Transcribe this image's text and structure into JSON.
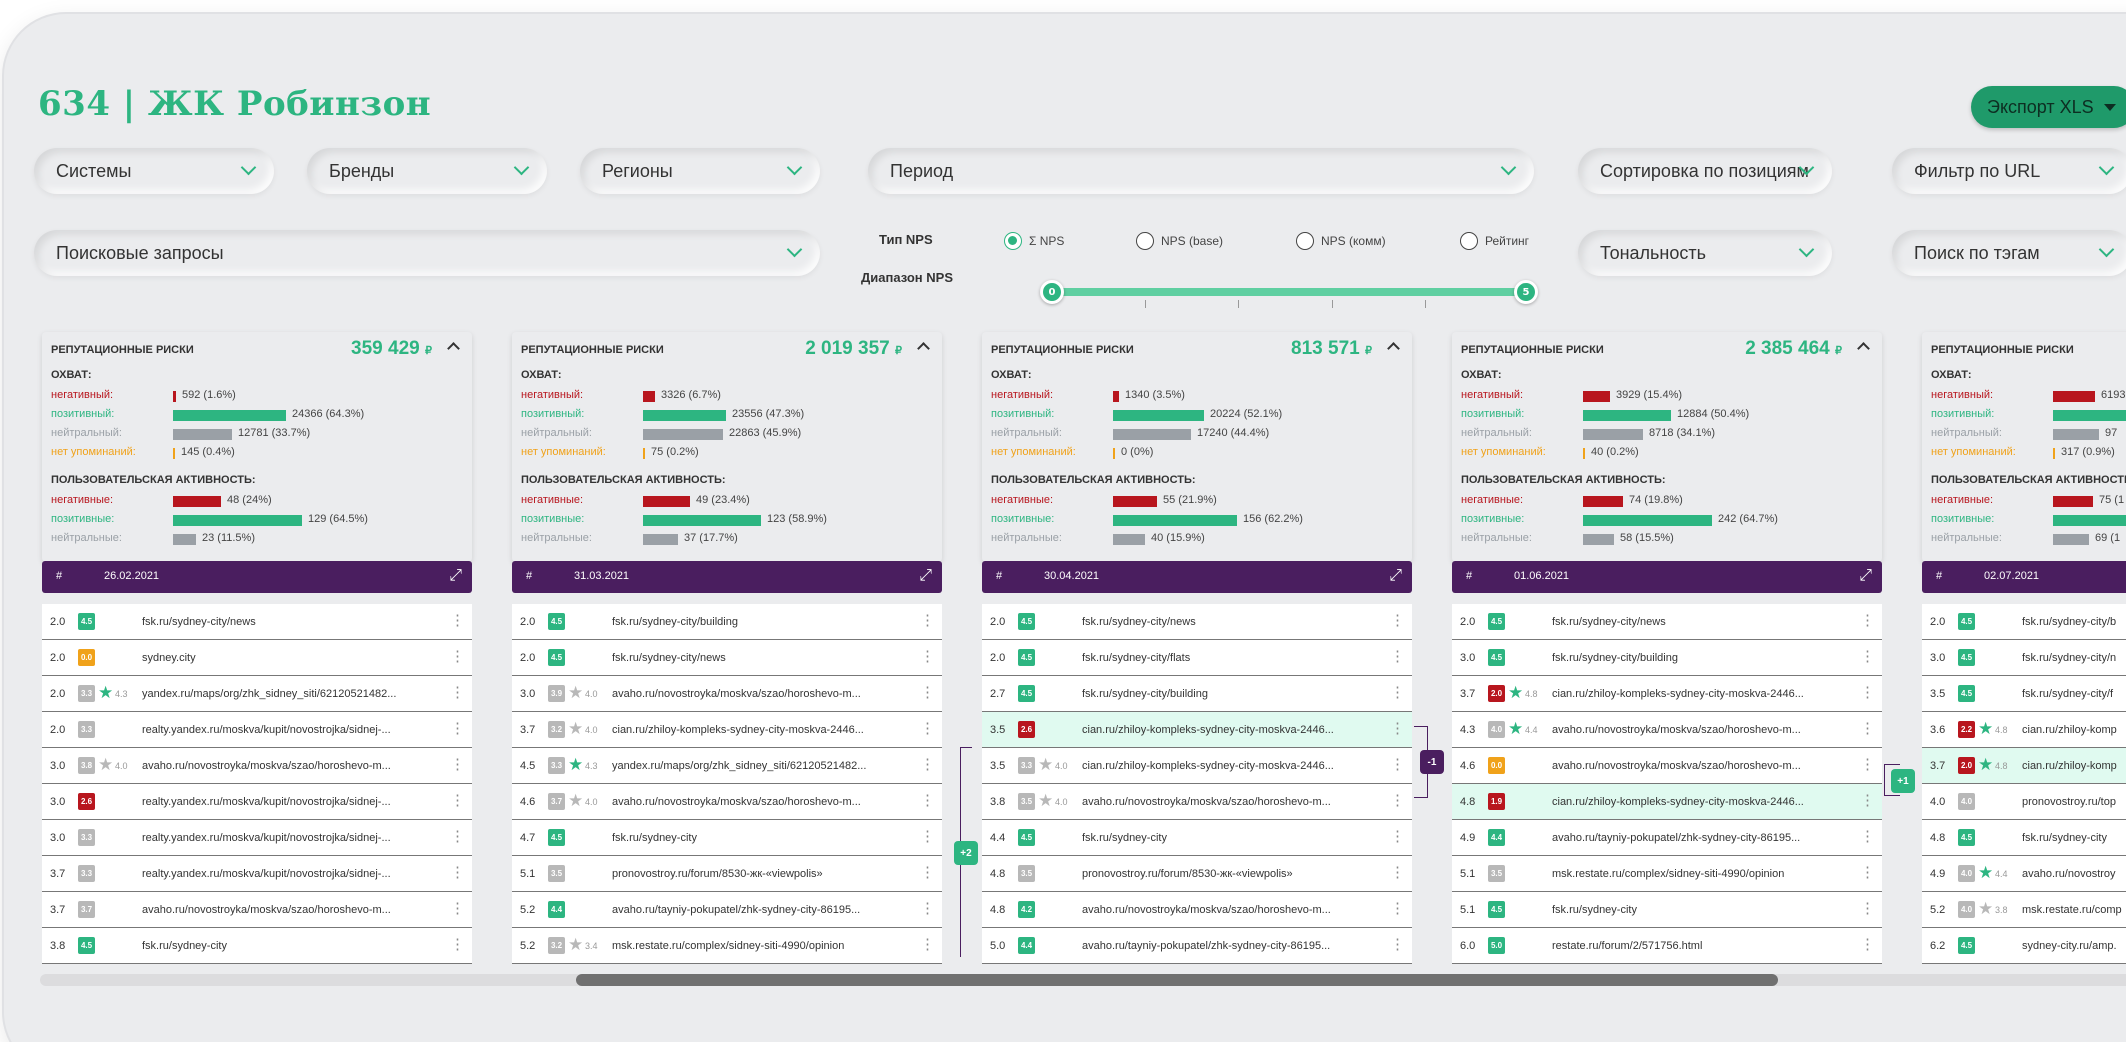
{
  "title": "634 | ЖК Робинзон",
  "export_button": "Экспорт XLS",
  "filters": {
    "systems": "Системы",
    "brands": "Бренды",
    "regions": "Регионы",
    "period": "Период",
    "sort": "Сортировка по позициям",
    "url_filter": "Фильтр по URL",
    "queries": "Поисковые запросы",
    "tonality": "Тональность",
    "tag_search": "Поиск по тэгам"
  },
  "nps": {
    "type_label": "Тип NPS",
    "range_label": "Диапазон NPS",
    "options": [
      {
        "label": "Σ NPS",
        "selected": true
      },
      {
        "label": "NPS (base)",
        "selected": false
      },
      {
        "label": "NPS (комм)",
        "selected": false
      },
      {
        "label": "Рейтинг",
        "selected": false
      }
    ],
    "range_min": "0",
    "range_max": "5"
  },
  "labels": {
    "risks": "РЕПУТАЦИОННЫЕ РИСКИ",
    "reach": "ОХВАТ:",
    "activity": "ПОЛЬЗОВАТЕЛЬСКАЯ АКТИВНОСТЬ:",
    "neg": "негативный:",
    "pos": "позитивный:",
    "neu": "нейтральный:",
    "none": "нет упоминаний:",
    "neg_pl": "негативные:",
    "pos_pl": "позитивные:",
    "neu_pl": "нейтральные:",
    "hash": "#",
    "currency": "₽"
  },
  "colors": {
    "accent": "#2db581",
    "purple": "#4a1e5f",
    "negative": "#b8161e",
    "neutral": "#9aa0a6",
    "none": "#f0a21a",
    "score_green": "#2db581",
    "score_gray": "#b8b8b8",
    "score_orange": "#f0a21a",
    "score_red": "#b8161e"
  },
  "columns": [
    {
      "risk_total": "359 429",
      "date": "26.02.2021",
      "reach": [
        {
          "kind": "neg",
          "text": "592 (1.6%)",
          "frac": 0.016
        },
        {
          "kind": "pos",
          "text": "24366 (64.3%)",
          "frac": 0.643
        },
        {
          "kind": "neu",
          "text": "12781 (33.7%)",
          "frac": 0.337
        },
        {
          "kind": "none",
          "text": "145 (0.4%)",
          "frac": 0.004
        }
      ],
      "activity": [
        {
          "kind": "neg",
          "text": "48 (24%)",
          "frac": 0.24
        },
        {
          "kind": "pos",
          "text": "129 (64.5%)",
          "frac": 0.645
        },
        {
          "kind": "neu",
          "text": "23 (11.5%)",
          "frac": 0.115
        }
      ],
      "rows": [
        {
          "pos": "2.0",
          "score": "4.5",
          "color": "green",
          "star": "",
          "rating": "",
          "url": "fsk.ru/sydney-city/news"
        },
        {
          "pos": "2.0",
          "score": "0.0",
          "color": "orange",
          "star": "",
          "rating": "",
          "url": "sydney.city"
        },
        {
          "pos": "2.0",
          "score": "3.3",
          "color": "gray",
          "star": "green",
          "rating": "4.3",
          "url": "yandex.ru/maps/org/zhk_sidney_siti/62120521482..."
        },
        {
          "pos": "2.0",
          "score": "3.3",
          "color": "gray",
          "star": "",
          "rating": "",
          "url": "realty.yandex.ru/moskva/kupit/novostrojka/sidnej-..."
        },
        {
          "pos": "3.0",
          "score": "3.8",
          "color": "gray",
          "star": "gray",
          "rating": "4.0",
          "url": "avaho.ru/novostroyka/moskva/szao/horoshevo-m..."
        },
        {
          "pos": "3.0",
          "score": "2.6",
          "color": "red",
          "star": "",
          "rating": "",
          "url": "realty.yandex.ru/moskva/kupit/novostrojka/sidnej-..."
        },
        {
          "pos": "3.0",
          "score": "3.3",
          "color": "gray",
          "star": "",
          "rating": "",
          "url": "realty.yandex.ru/moskva/kupit/novostrojka/sidnej-..."
        },
        {
          "pos": "3.7",
          "score": "3.3",
          "color": "gray",
          "star": "",
          "rating": "",
          "url": "realty.yandex.ru/moskva/kupit/novostrojka/sidnej-..."
        },
        {
          "pos": "3.7",
          "score": "3.7",
          "color": "gray",
          "star": "",
          "rating": "",
          "url": "avaho.ru/novostroyka/moskva/szao/horoshevo-m..."
        },
        {
          "pos": "3.8",
          "score": "4.5",
          "color": "green",
          "star": "",
          "rating": "",
          "url": "fsk.ru/sydney-city"
        }
      ]
    },
    {
      "risk_total": "2 019 357",
      "date": "31.03.2021",
      "reach": [
        {
          "kind": "neg",
          "text": "3326 (6.7%)",
          "frac": 0.067
        },
        {
          "kind": "pos",
          "text": "23556 (47.3%)",
          "frac": 0.473
        },
        {
          "kind": "neu",
          "text": "22863 (45.9%)",
          "frac": 0.459
        },
        {
          "kind": "none",
          "text": "75 (0.2%)",
          "frac": 0.002
        }
      ],
      "activity": [
        {
          "kind": "neg",
          "text": "49 (23.4%)",
          "frac": 0.234
        },
        {
          "kind": "pos",
          "text": "123 (58.9%)",
          "frac": 0.589
        },
        {
          "kind": "neu",
          "text": "37 (17.7%)",
          "frac": 0.177
        }
      ],
      "rows": [
        {
          "pos": "2.0",
          "score": "4.5",
          "color": "green",
          "star": "",
          "rating": "",
          "url": "fsk.ru/sydney-city/building"
        },
        {
          "pos": "2.0",
          "score": "4.5",
          "color": "green",
          "star": "",
          "rating": "",
          "url": "fsk.ru/sydney-city/news"
        },
        {
          "pos": "3.0",
          "score": "3.9",
          "color": "gray",
          "star": "gray",
          "rating": "4.0",
          "url": "avaho.ru/novostroyka/moskva/szao/horoshevo-m..."
        },
        {
          "pos": "3.7",
          "score": "3.2",
          "color": "gray",
          "star": "gray",
          "rating": "4.0",
          "url": "cian.ru/zhiloy-kompleks-sydney-city-moskva-2446..."
        },
        {
          "pos": "4.5",
          "score": "3.3",
          "color": "gray",
          "star": "green",
          "rating": "4.3",
          "url": "yandex.ru/maps/org/zhk_sidney_siti/62120521482..."
        },
        {
          "pos": "4.6",
          "score": "3.7",
          "color": "gray",
          "star": "gray",
          "rating": "4.0",
          "url": "avaho.ru/novostroyka/moskva/szao/horoshevo-m..."
        },
        {
          "pos": "4.7",
          "score": "4.5",
          "color": "green",
          "star": "",
          "rating": "",
          "url": "fsk.ru/sydney-city"
        },
        {
          "pos": "5.1",
          "score": "3.5",
          "color": "gray",
          "star": "",
          "rating": "",
          "url": "pronovostroy.ru/forum/8530-жк-«viewpolis»"
        },
        {
          "pos": "5.2",
          "score": "4.4",
          "color": "green",
          "star": "",
          "rating": "",
          "url": "avaho.ru/tayniy-pokupatel/zhk-sydney-city-86195..."
        },
        {
          "pos": "5.2",
          "score": "3.2",
          "color": "gray",
          "star": "gray",
          "rating": "3.4",
          "url": "msk.restate.ru/complex/sidney-siti-4990/opinion"
        }
      ]
    },
    {
      "risk_total": "813 571",
      "date": "30.04.2021",
      "reach": [
        {
          "kind": "neg",
          "text": "1340 (3.5%)",
          "frac": 0.035
        },
        {
          "kind": "pos",
          "text": "20224 (52.1%)",
          "frac": 0.521
        },
        {
          "kind": "neu",
          "text": "17240 (44.4%)",
          "frac": 0.444
        },
        {
          "kind": "none",
          "text": "0 (0%)",
          "frac": 0.0
        }
      ],
      "activity": [
        {
          "kind": "neg",
          "text": "55 (21.9%)",
          "frac": 0.219
        },
        {
          "kind": "pos",
          "text": "156 (62.2%)",
          "frac": 0.622
        },
        {
          "kind": "neu",
          "text": "40 (15.9%)",
          "frac": 0.159
        }
      ],
      "rows": [
        {
          "pos": "2.0",
          "score": "4.5",
          "color": "green",
          "star": "",
          "rating": "",
          "url": "fsk.ru/sydney-city/news"
        },
        {
          "pos": "2.0",
          "score": "4.5",
          "color": "green",
          "star": "",
          "rating": "",
          "url": "fsk.ru/sydney-city/flats"
        },
        {
          "pos": "2.7",
          "score": "4.5",
          "color": "green",
          "star": "",
          "rating": "",
          "url": "fsk.ru/sydney-city/building"
        },
        {
          "pos": "3.5",
          "score": "2.6",
          "color": "red",
          "star": "",
          "rating": "",
          "url": "cian.ru/zhiloy-kompleks-sydney-city-moskva-2446...",
          "hl": true
        },
        {
          "pos": "3.5",
          "score": "3.3",
          "color": "gray",
          "star": "gray",
          "rating": "4.0",
          "url": "cian.ru/zhiloy-kompleks-sydney-city-moskva-2446..."
        },
        {
          "pos": "3.8",
          "score": "3.5",
          "color": "gray",
          "star": "gray",
          "rating": "4.0",
          "url": "avaho.ru/novostroyka/moskva/szao/horoshevo-m..."
        },
        {
          "pos": "4.4",
          "score": "4.5",
          "color": "green",
          "star": "",
          "rating": "",
          "url": "fsk.ru/sydney-city"
        },
        {
          "pos": "4.8",
          "score": "3.5",
          "color": "gray",
          "star": "",
          "rating": "",
          "url": "pronovostroy.ru/forum/8530-жк-«viewpolis»"
        },
        {
          "pos": "4.8",
          "score": "4.2",
          "color": "green",
          "star": "",
          "rating": "",
          "url": "avaho.ru/novostroyka/moskva/szao/horoshevo-m..."
        },
        {
          "pos": "5.0",
          "score": "4.4",
          "color": "green",
          "star": "",
          "rating": "",
          "url": "avaho.ru/tayniy-pokupatel/zhk-sydney-city-86195..."
        }
      ]
    },
    {
      "risk_total": "2 385 464",
      "date": "01.06.2021",
      "reach": [
        {
          "kind": "neg",
          "text": "3929 (15.4%)",
          "frac": 0.154
        },
        {
          "kind": "pos",
          "text": "12884 (50.4%)",
          "frac": 0.504
        },
        {
          "kind": "neu",
          "text": "8718 (34.1%)",
          "frac": 0.341
        },
        {
          "kind": "none",
          "text": "40 (0.2%)",
          "frac": 0.002
        }
      ],
      "activity": [
        {
          "kind": "neg",
          "text": "74 (19.8%)",
          "frac": 0.198
        },
        {
          "kind": "pos",
          "text": "242 (64.7%)",
          "frac": 0.647
        },
        {
          "kind": "neu",
          "text": "58 (15.5%)",
          "frac": 0.155
        }
      ],
      "rows": [
        {
          "pos": "2.0",
          "score": "4.5",
          "color": "green",
          "star": "",
          "rating": "",
          "url": "fsk.ru/sydney-city/news"
        },
        {
          "pos": "3.0",
          "score": "4.5",
          "color": "green",
          "star": "",
          "rating": "",
          "url": "fsk.ru/sydney-city/building"
        },
        {
          "pos": "3.7",
          "score": "2.0",
          "color": "red",
          "star": "green",
          "rating": "4.8",
          "url": "cian.ru/zhiloy-kompleks-sydney-city-moskva-2446..."
        },
        {
          "pos": "4.3",
          "score": "4.0",
          "color": "gray",
          "star": "green",
          "rating": "4.4",
          "url": "avaho.ru/novostroyka/moskva/szao/horoshevo-m..."
        },
        {
          "pos": "4.6",
          "score": "0.0",
          "color": "orange",
          "star": "",
          "rating": "",
          "url": "avaho.ru/novostroyka/moskva/szao/horoshevo-m..."
        },
        {
          "pos": "4.8",
          "score": "1.9",
          "color": "red",
          "star": "",
          "rating": "",
          "url": "cian.ru/zhiloy-kompleks-sydney-city-moskva-2446...",
          "hl": true
        },
        {
          "pos": "4.9",
          "score": "4.4",
          "color": "green",
          "star": "",
          "rating": "",
          "url": "avaho.ru/tayniy-pokupatel/zhk-sydney-city-86195..."
        },
        {
          "pos": "5.1",
          "score": "3.5",
          "color": "gray",
          "star": "",
          "rating": "",
          "url": "msk.restate.ru/complex/sidney-siti-4990/opinion"
        },
        {
          "pos": "5.1",
          "score": "4.5",
          "color": "green",
          "star": "",
          "rating": "",
          "url": "fsk.ru/sydney-city"
        },
        {
          "pos": "6.0",
          "score": "5.0",
          "color": "green",
          "star": "",
          "rating": "",
          "url": "restate.ru/forum/2/571756.html"
        }
      ]
    },
    {
      "risk_total": "",
      "date": "02.07.2021",
      "reach": [
        {
          "kind": "neg",
          "text": "6193 (",
          "frac": 0.24
        },
        {
          "kind": "pos",
          "text": "",
          "frac": 0.5
        },
        {
          "kind": "neu",
          "text": "97",
          "frac": 0.26
        },
        {
          "kind": "none",
          "text": "317 (0.9%)",
          "frac": 0.009
        }
      ],
      "activity": [
        {
          "kind": "neg",
          "text": "75 (1",
          "frac": 0.2
        },
        {
          "kind": "pos",
          "text": "",
          "frac": 0.62
        },
        {
          "kind": "neu",
          "text": "69 (1",
          "frac": 0.18
        }
      ],
      "rows": [
        {
          "pos": "2.0",
          "score": "4.5",
          "color": "green",
          "star": "",
          "rating": "",
          "url": "fsk.ru/sydney-city/b"
        },
        {
          "pos": "3.0",
          "score": "4.5",
          "color": "green",
          "star": "",
          "rating": "",
          "url": "fsk.ru/sydney-city/n"
        },
        {
          "pos": "3.5",
          "score": "4.5",
          "color": "green",
          "star": "",
          "rating": "",
          "url": "fsk.ru/sydney-city/f"
        },
        {
          "pos": "3.6",
          "score": "2.2",
          "color": "red",
          "star": "green",
          "rating": "4.8",
          "url": "cian.ru/zhiloy-komp"
        },
        {
          "pos": "3.7",
          "score": "2.0",
          "color": "red",
          "star": "green",
          "rating": "4.8",
          "url": "cian.ru/zhiloy-komp",
          "hl": true
        },
        {
          "pos": "4.0",
          "score": "4.0",
          "color": "gray",
          "star": "",
          "rating": "",
          "url": "pronovostroy.ru/top"
        },
        {
          "pos": "4.8",
          "score": "4.5",
          "color": "green",
          "star": "",
          "rating": "",
          "url": "fsk.ru/sydney-city"
        },
        {
          "pos": "4.9",
          "score": "4.0",
          "color": "gray",
          "star": "green",
          "rating": "4.4",
          "url": "avaho.ru/novostroy"
        },
        {
          "pos": "5.2",
          "score": "4.0",
          "color": "gray",
          "star": "gray",
          "rating": "3.8",
          "url": "msk.restate.ru/comp"
        },
        {
          "pos": "6.2",
          "score": "4.5",
          "color": "green",
          "star": "",
          "rating": "",
          "url": "sydney-city.ru/amp."
        }
      ]
    }
  ],
  "position_changes": [
    {
      "text": "+2",
      "color": "#2db581"
    },
    {
      "text": "-1",
      "color": "#4a1e5f"
    },
    {
      "text": "+1",
      "color": "#2db581"
    }
  ]
}
